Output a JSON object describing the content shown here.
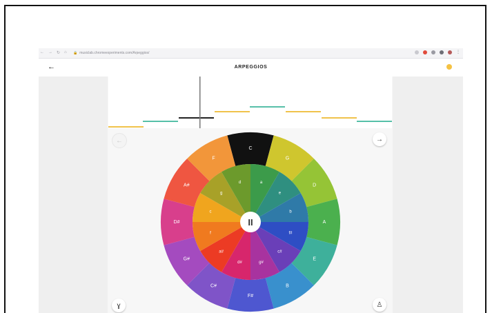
{
  "browser": {
    "url": "musiclab.chromeexperiments.com/Arpeggios/",
    "icons": [
      "back-icon",
      "forward-icon",
      "reload-icon",
      "home-icon",
      "info-icon",
      "extensions-icon",
      "profile-icon",
      "menu-icon"
    ]
  },
  "header": {
    "title": "ARPEGGIOS"
  },
  "controls": {
    "pause_label": "II"
  },
  "wheel": {
    "outer": [
      {
        "label": "C",
        "color": "#111111"
      },
      {
        "label": "G",
        "color": "#cfc62e"
      },
      {
        "label": "D",
        "color": "#95c436"
      },
      {
        "label": "A",
        "color": "#4bb04e"
      },
      {
        "label": "E",
        "color": "#3eb09b"
      },
      {
        "label": "B",
        "color": "#3990cd"
      },
      {
        "label": "F#",
        "color": "#4e57d0"
      },
      {
        "label": "C#",
        "color": "#7f54c8"
      },
      {
        "label": "G#",
        "color": "#a44bbf"
      },
      {
        "label": "D#",
        "color": "#d83f8c"
      },
      {
        "label": "A#",
        "color": "#ef5641"
      },
      {
        "label": "F",
        "color": "#f2963a"
      }
    ],
    "inner": [
      {
        "label": "a",
        "color": "#3c9b4a"
      },
      {
        "label": "e",
        "color": "#2f8f80"
      },
      {
        "label": "b",
        "color": "#2f7aa8"
      },
      {
        "label": "f#",
        "color": "#2e4ec4"
      },
      {
        "label": "c#",
        "color": "#6a3fb8"
      },
      {
        "label": "g#",
        "color": "#a8339f"
      },
      {
        "label": "d#",
        "color": "#d7266c"
      },
      {
        "label": "a#",
        "color": "#ec3b24"
      },
      {
        "label": "f",
        "color": "#f07a1f"
      },
      {
        "label": "c",
        "color": "#f0a51e"
      },
      {
        "label": "g",
        "color": "#a8a128"
      },
      {
        "label": "d",
        "color": "#6c9a2c"
      }
    ]
  },
  "roll": {
    "notes": [
      {
        "color": "#f0c24a"
      },
      {
        "color": "#56bfa8"
      },
      {
        "color": "#222222"
      },
      {
        "color": "#f0c24a"
      },
      {
        "color": "#56bfa8"
      },
      {
        "color": "#f0c24a"
      },
      {
        "color": "#f0c24a"
      },
      {
        "color": "#56bfa8"
      }
    ],
    "active_index": 2
  }
}
